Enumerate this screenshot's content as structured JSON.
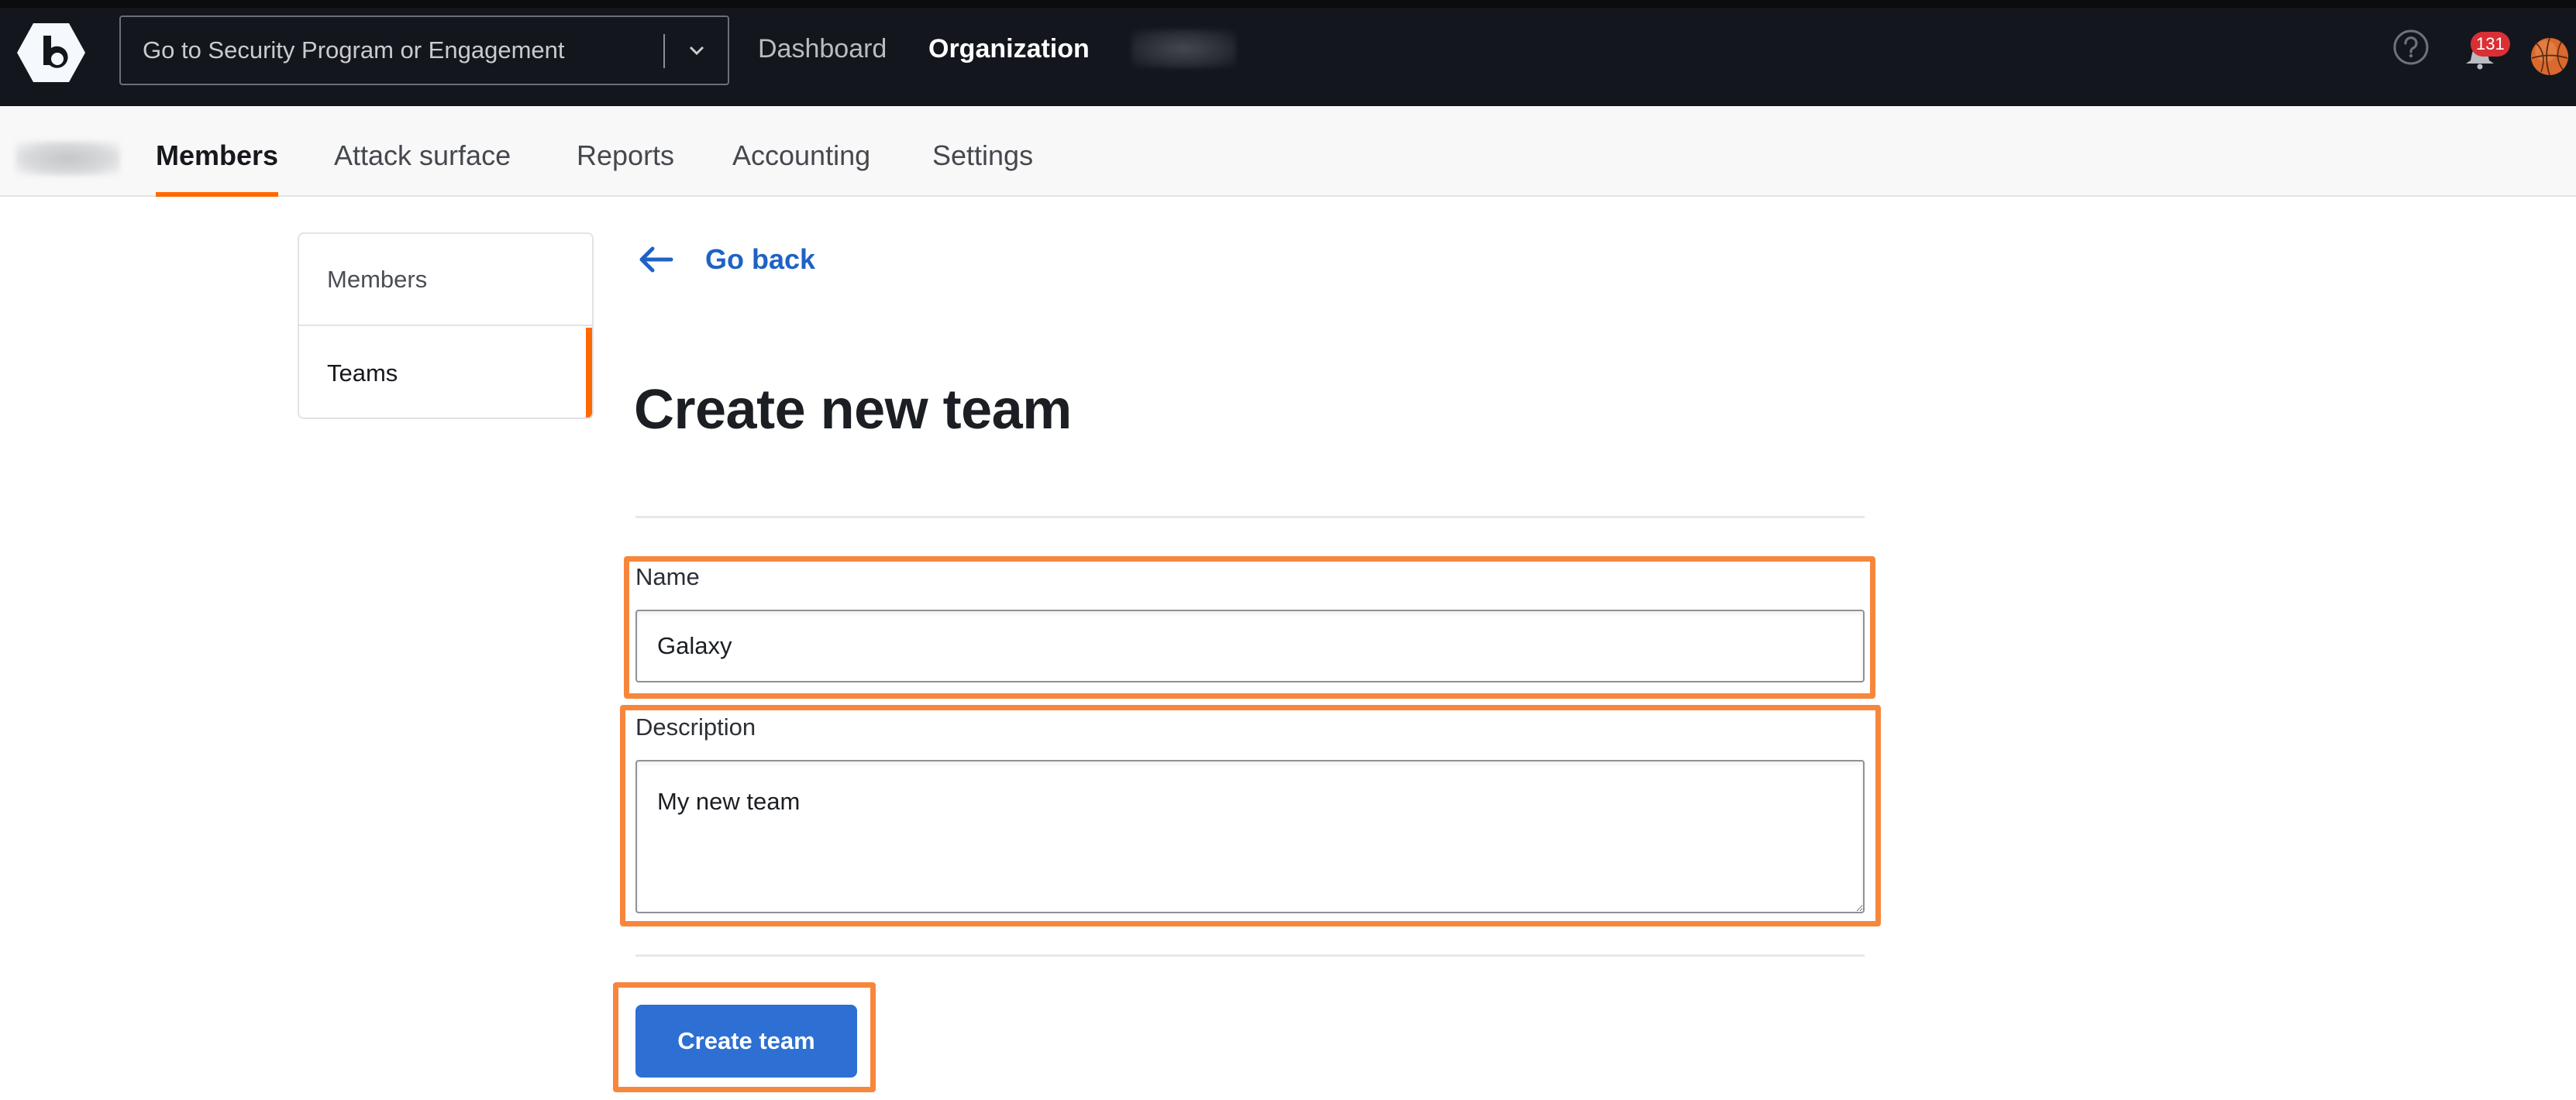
{
  "topnav": {
    "logo_letter": "b",
    "program_select": {
      "placeholder": "Go to Security Program or Engagement",
      "chevron_icon": "chevron-down-icon"
    },
    "links": [
      {
        "label": "Dashboard",
        "active": false
      },
      {
        "label": "Organization",
        "active": true
      }
    ],
    "help_icon": "question-circle-icon",
    "notifications": {
      "icon": "bell-icon",
      "count": "131"
    },
    "avatar_icon": "basketball-avatar"
  },
  "subnav": {
    "tabs": [
      {
        "label": "Members",
        "active": true
      },
      {
        "label": "Attack surface",
        "active": false
      },
      {
        "label": "Reports",
        "active": false
      },
      {
        "label": "Accounting",
        "active": false
      },
      {
        "label": "Settings",
        "active": false
      }
    ]
  },
  "sidebar": {
    "items": [
      {
        "label": "Members",
        "active": false
      },
      {
        "label": "Teams",
        "active": true
      }
    ]
  },
  "main": {
    "go_back_label": "Go back",
    "title": "Create new team",
    "form": {
      "name_label": "Name",
      "name_value": "Galaxy",
      "description_label": "Description",
      "description_value": "My new team",
      "submit_label": "Create team"
    }
  },
  "colors": {
    "brand_orange": "#ff6a00",
    "highlight_orange": "#f7863d",
    "link_blue": "#1f62c5",
    "button_blue": "#2d6fd2",
    "nav_dark": "#13161d",
    "badge_red": "#d93035"
  }
}
